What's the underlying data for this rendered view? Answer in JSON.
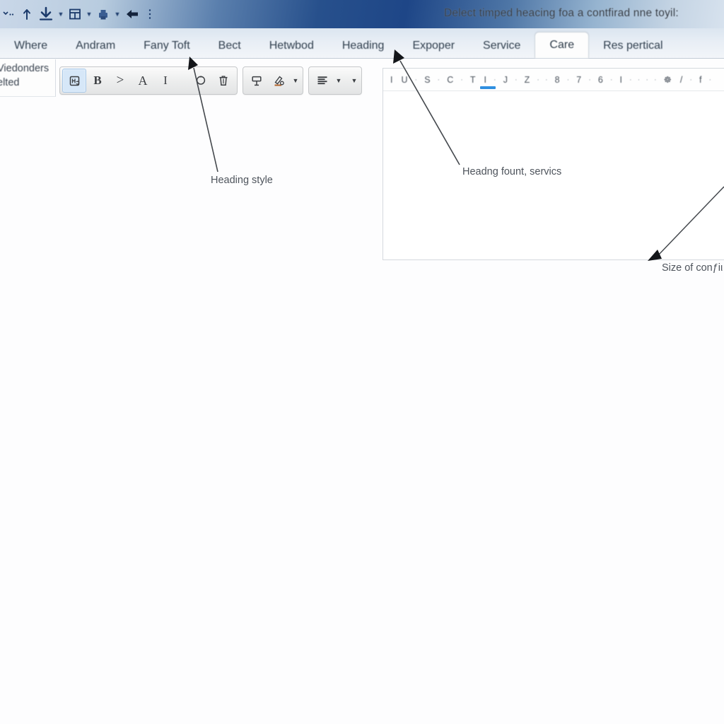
{
  "window": {
    "title": "Delect timped heacing foa a contfirad nne toyil:",
    "quick_icons": [
      {
        "name": "chevron-small-icon",
        "glyph": "ˇ"
      },
      {
        "name": "upload-arrow-icon",
        "glyph": "↑"
      },
      {
        "name": "download-arrow-icon",
        "glyph": "↓"
      },
      {
        "name": "table-icon",
        "glyph": "▤"
      },
      {
        "name": "print-icon",
        "glyph": "⎙"
      },
      {
        "name": "undo-arrow-icon",
        "glyph": "⬅"
      },
      {
        "name": "overflow-menu-icon",
        "glyph": "⋮"
      }
    ]
  },
  "tabs": [
    {
      "label": "Where",
      "active": false
    },
    {
      "label": "Andram",
      "active": false
    },
    {
      "label": "Fany Toft",
      "active": false
    },
    {
      "label": "Bect",
      "active": false
    },
    {
      "label": "Hetwbod",
      "active": false
    },
    {
      "label": "Heading",
      "active": false
    },
    {
      "label": "Expoper",
      "active": false
    },
    {
      "label": "Service",
      "active": false
    },
    {
      "label": "Care",
      "active": true
    },
    {
      "label": "Res pertical",
      "active": false
    }
  ],
  "sidebar": {
    "line1": "Viedonders",
    "line2": "elted"
  },
  "format_toolbar": {
    "group1": [
      {
        "name": "heading-style-icon",
        "label": "☷",
        "selected": true
      },
      {
        "name": "bold-icon",
        "label": "B",
        "selected": false
      },
      {
        "name": "quote-icon",
        "label": ">",
        "selected": false
      },
      {
        "name": "text-style-icon",
        "label": "A",
        "selected": false
      },
      {
        "name": "italic-icon",
        "label": "I",
        "selected": false
      },
      {
        "name": "circle-shape-icon",
        "label": "⬡",
        "selected": false
      },
      {
        "name": "trash-icon",
        "label": "Ὕ1",
        "selected": false
      }
    ],
    "group2": [
      {
        "name": "clear-format-icon",
        "label": "⚑",
        "selected": false
      },
      {
        "name": "highlight-color-icon",
        "label": "✎",
        "selected": false,
        "has_caret": true
      }
    ],
    "group3": [
      {
        "name": "align-icon",
        "label": "☰",
        "selected": false,
        "has_caret": true
      },
      {
        "name": "more-options-caret-icon",
        "label": "",
        "selected": false,
        "has_caret": true
      }
    ]
  },
  "ruler": {
    "marks": [
      "I",
      "U",
      "·",
      "S",
      "·",
      "C",
      "·",
      "T",
      "I",
      "·",
      "J",
      "·",
      "Z",
      "·",
      "·",
      "8",
      "·",
      "7",
      "·",
      "6",
      "·",
      "I",
      "·",
      "·",
      "·",
      "·",
      "☸",
      "/",
      "·",
      "f",
      "·"
    ]
  },
  "annotations": [
    {
      "name": "annotation-heading-style",
      "text": "Heading style"
    },
    {
      "name": "annotation-heading-font",
      "text": "Headng fount, servics"
    },
    {
      "name": "annotation-size-content",
      "text": "Size of conƒiι"
    }
  ],
  "colors": {
    "titlebar_blue": "#27508c",
    "accent": "#2f8fe0",
    "selected_button": "#d6e7f8",
    "page_bg": "#fdfdfe"
  }
}
